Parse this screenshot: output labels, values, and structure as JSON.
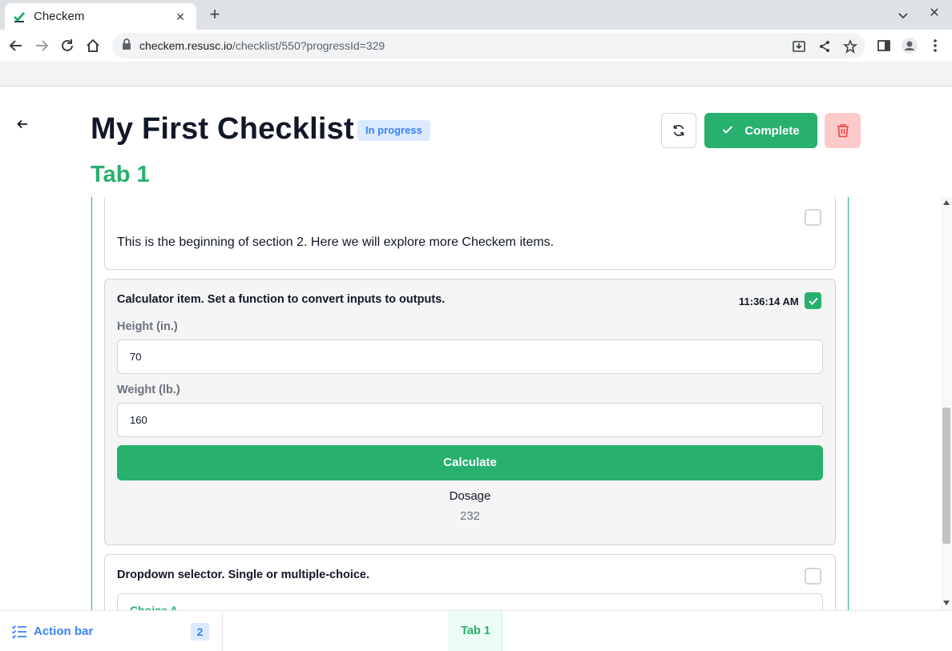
{
  "browser": {
    "tab_title": "Checkem",
    "url_host": "checkem.resusc.io",
    "url_path": "/checklist/550?progressId=329"
  },
  "checklist": {
    "title": "My First Checklist",
    "status": "In progress",
    "complete_label": "Complete",
    "active_tab": "Tab 1"
  },
  "items": {
    "section": {
      "text": "This is the beginning of section 2. Here we will explore more Checkem items.",
      "checked": false
    },
    "calculator": {
      "title": "Calculator item. Set a function to convert inputs to outputs.",
      "timestamp": "11:36:14 AM",
      "checked": true,
      "inputs": [
        {
          "label": "Height (in.)",
          "value": "70"
        },
        {
          "label": "Weight (lb.)",
          "value": "160"
        }
      ],
      "button_label": "Calculate",
      "output_label": "Dosage",
      "output_value": "232"
    },
    "dropdown": {
      "title": "Dropdown selector. Single or multiple-choice.",
      "selected": "Choice A",
      "checked": false
    }
  },
  "bottom_bar": {
    "action_label": "Action bar",
    "action_count": "2",
    "tab_label": "Tab 1"
  },
  "colors": {
    "accent_green": "#27b06e",
    "badge_blue": "#3b82f6",
    "danger_bg": "#fecaca",
    "danger_icon": "#ef4444"
  }
}
